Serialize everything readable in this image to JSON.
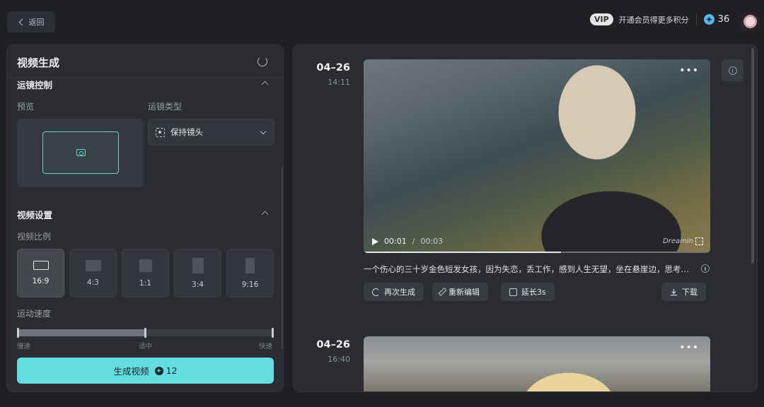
{
  "topbar": {
    "back_label": "返回",
    "vip_badge": "VIP",
    "vip_text": "开通会员得更多积分",
    "points": "36"
  },
  "left_panel": {
    "title": "视频生成",
    "camera_section": {
      "heading": "运镜控制",
      "preview_label": "预览",
      "type_label": "运镜类型",
      "type_value": "保持镜头"
    },
    "video_section": {
      "heading": "视频设置",
      "ratio_label": "视频比例",
      "ratios": [
        {
          "label": "16:9",
          "selected": true
        },
        {
          "label": "4:3",
          "selected": false
        },
        {
          "label": "1:1",
          "selected": false
        },
        {
          "label": "3:4",
          "selected": false
        },
        {
          "label": "9:16",
          "selected": false
        }
      ],
      "speed_label": "运动速度",
      "speed_min": "慢速",
      "speed_mid": "适中",
      "speed_max": "快速",
      "speed_value": 0.5
    },
    "generate_button": {
      "label": "生成视频",
      "cost": "12"
    }
  },
  "results": [
    {
      "date": "04–26",
      "time": "14:11",
      "current_time": "00:01",
      "separator": "/",
      "duration": "00:03",
      "watermark": "Dreamin",
      "progress": 0.57,
      "prompt": "一个伤心的三十岁金色短发女孩，因为失恋，丢工作，感到人生无望，坐在悬崖边，思考人生",
      "actions": {
        "regenerate": "再次生成",
        "re_edit": "重新编辑",
        "extend": "延长3s",
        "download": "下载"
      }
    },
    {
      "date": "04–26",
      "time": "16:40"
    }
  ],
  "colors": {
    "accent": "#63dde0",
    "panel_bg": "#2a2c32",
    "page_bg": "#1f2024"
  }
}
